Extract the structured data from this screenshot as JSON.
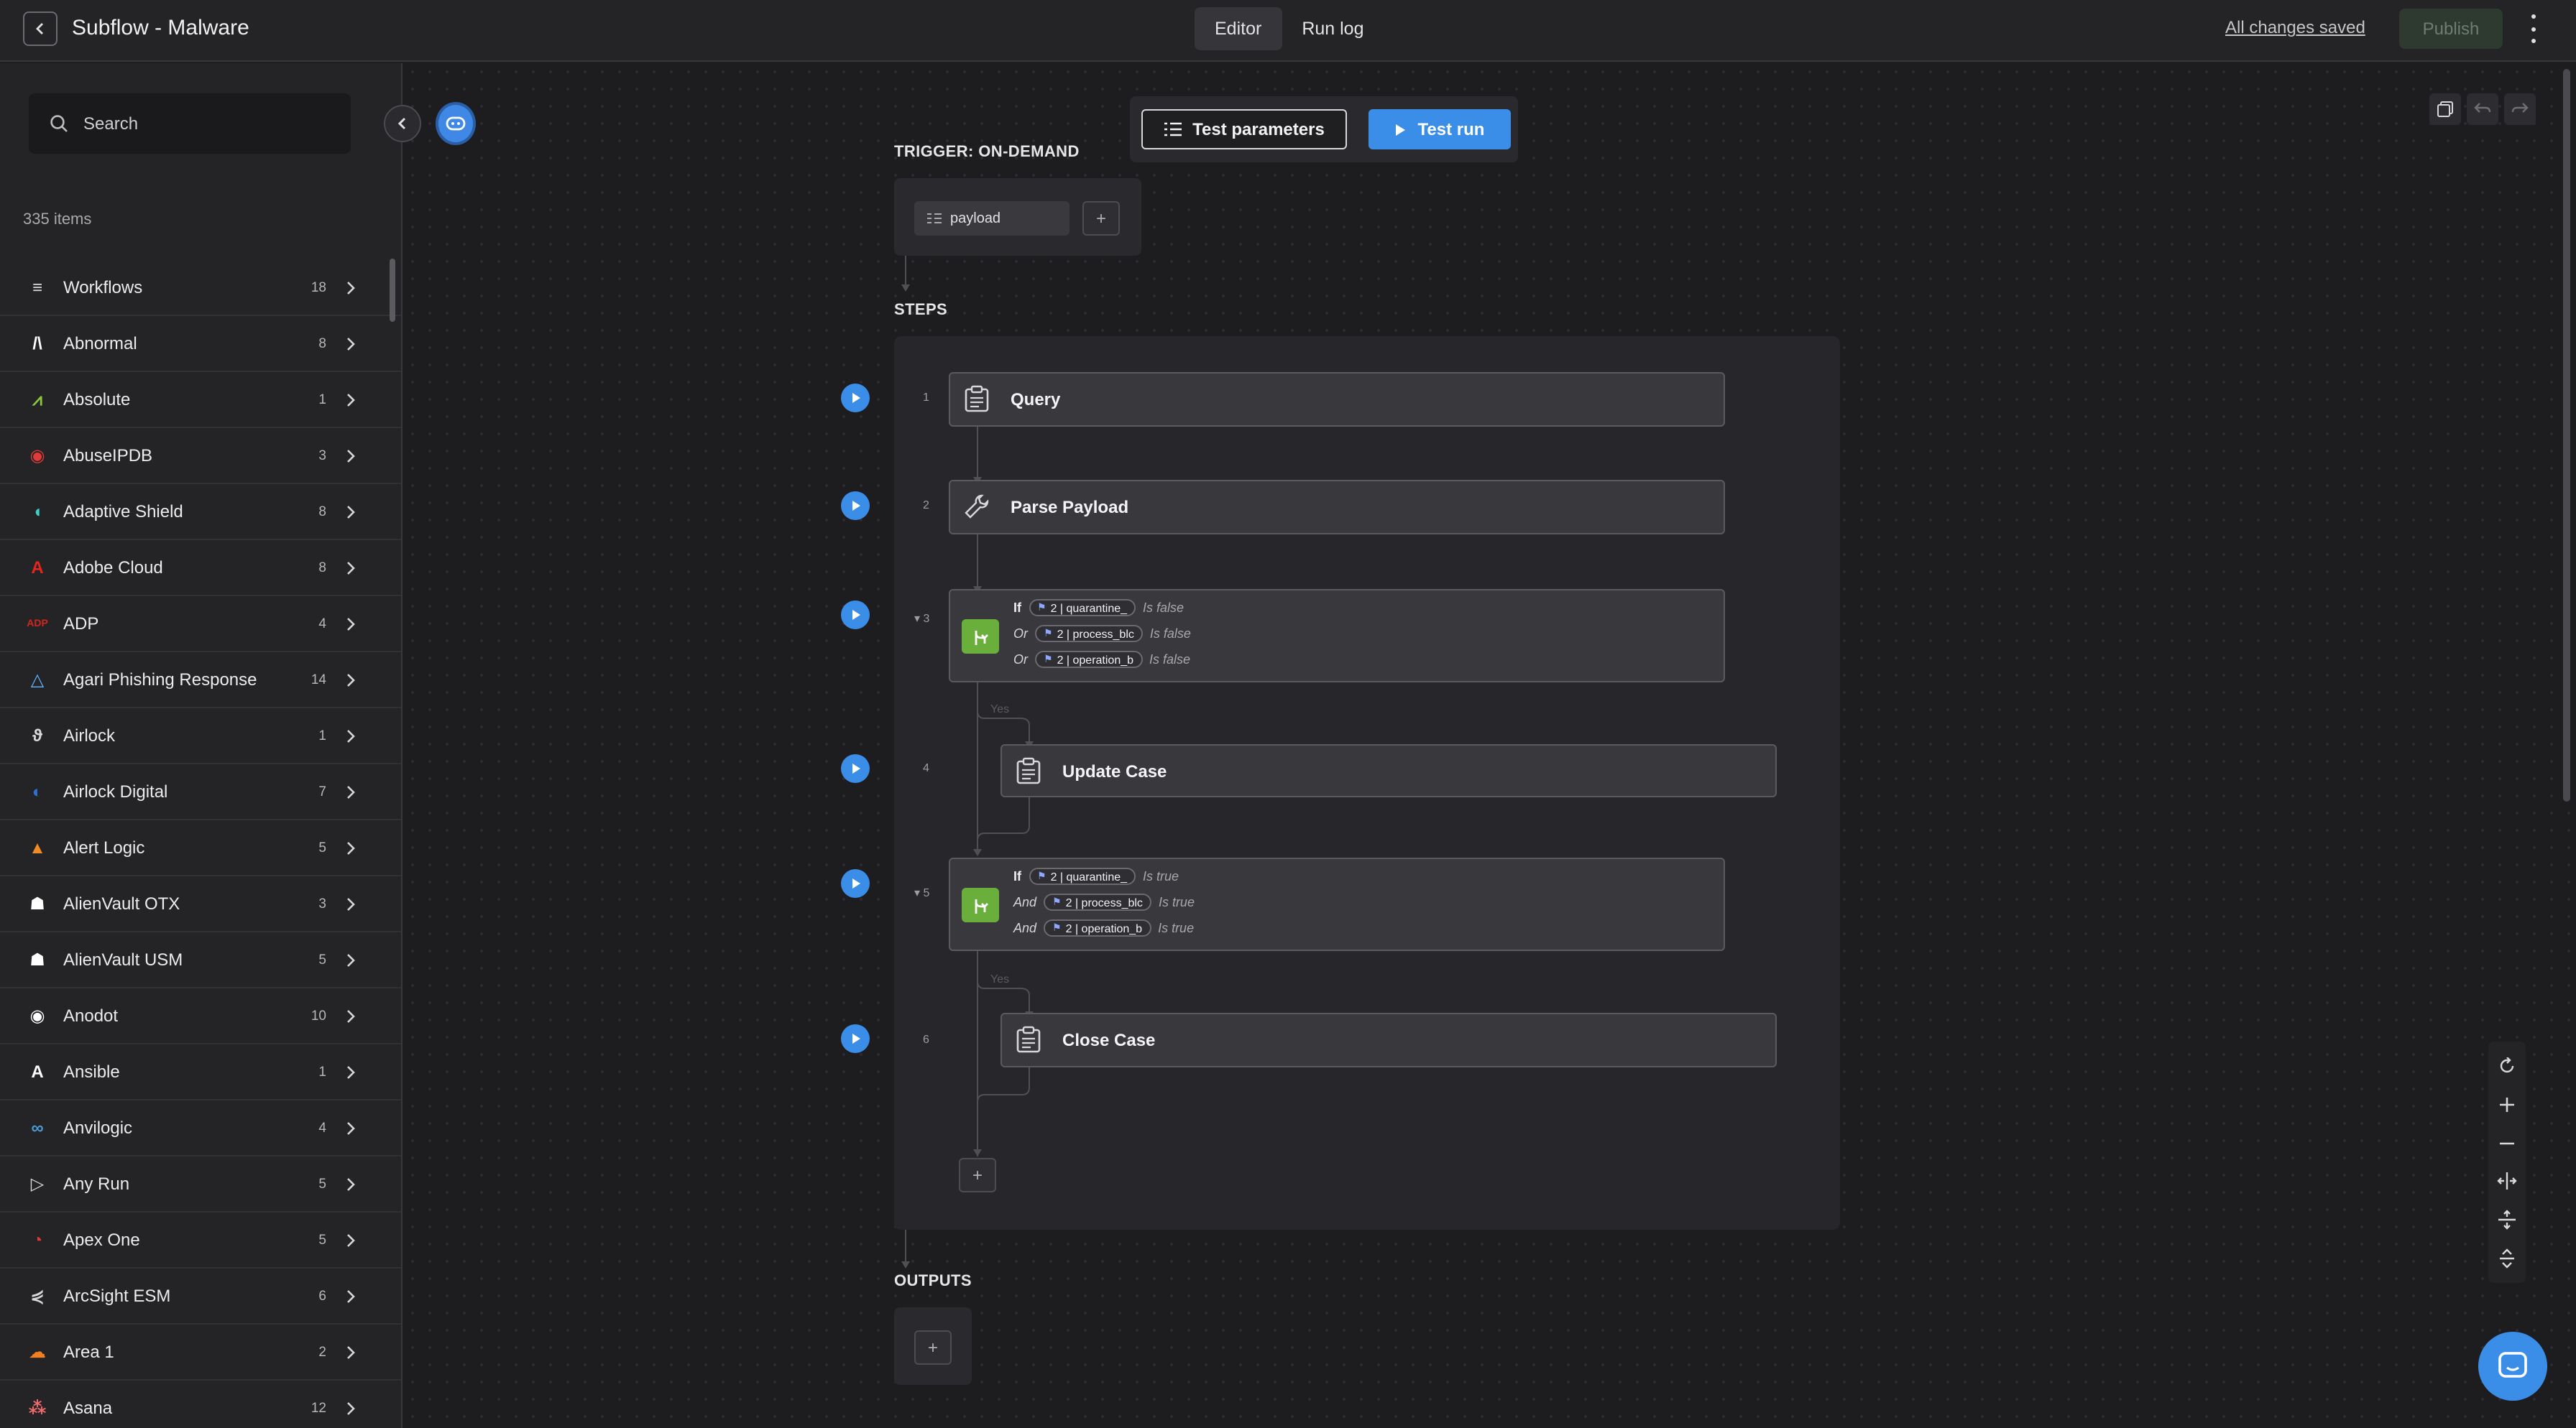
{
  "header": {
    "title": "Subflow - Malware",
    "tabs": [
      {
        "label": "Editor",
        "active": true
      },
      {
        "label": "Run log",
        "active": false
      }
    ],
    "saved_status": "All changes saved",
    "publish_label": "Publish"
  },
  "sidebar": {
    "search_placeholder": "Search",
    "items_count": "335 items",
    "items": [
      {
        "name": "Workflows",
        "count": "18",
        "icon": "workflows-icon",
        "color": "#d8d8db"
      },
      {
        "name": "Abnormal",
        "count": "8",
        "icon": "abnormal-logo",
        "color": "#ffffff"
      },
      {
        "name": "Absolute",
        "count": "1",
        "icon": "absolute-logo",
        "color": "#8cc63f"
      },
      {
        "name": "AbuseIPDB",
        "count": "3",
        "icon": "abuseipdb-logo",
        "color": "#e03a3a"
      },
      {
        "name": "Adaptive Shield",
        "count": "8",
        "icon": "adaptive-shield-logo",
        "color": "#3fd0c9"
      },
      {
        "name": "Adobe Cloud",
        "count": "8",
        "icon": "adobe-logo",
        "color": "#e5261f"
      },
      {
        "name": "ADP",
        "count": "4",
        "icon": "adp-logo",
        "color": "#d0271d"
      },
      {
        "name": "Agari Phishing Response",
        "count": "14",
        "icon": "agari-logo",
        "color": "#5fb8ff"
      },
      {
        "name": "Airlock",
        "count": "1",
        "icon": "airlock-logo",
        "color": "#d8d8db"
      },
      {
        "name": "Airlock Digital",
        "count": "7",
        "icon": "airlock-digital-logo",
        "color": "#2f6fd6"
      },
      {
        "name": "Alert Logic",
        "count": "5",
        "icon": "alert-logic-logo",
        "color": "#f08a24"
      },
      {
        "name": "AlienVault OTX",
        "count": "3",
        "icon": "alien-icon",
        "color": "#ffffff"
      },
      {
        "name": "AlienVault USM",
        "count": "5",
        "icon": "alien-icon",
        "color": "#ffffff"
      },
      {
        "name": "Anodot",
        "count": "10",
        "icon": "anodot-logo",
        "color": "#ffffff"
      },
      {
        "name": "Ansible",
        "count": "1",
        "icon": "ansible-logo",
        "color": "#ffffff"
      },
      {
        "name": "Anvilogic",
        "count": "4",
        "icon": "anvilogic-logo",
        "color": "#4a9bd6"
      },
      {
        "name": "Any Run",
        "count": "5",
        "icon": "any-run-logo",
        "color": "#d8d8db"
      },
      {
        "name": "Apex One",
        "count": "5",
        "icon": "apex-one-logo",
        "color": "#e03a3a"
      },
      {
        "name": "ArcSight ESM",
        "count": "6",
        "icon": "arcsight-logo",
        "color": "#d8d8db"
      },
      {
        "name": "Area 1",
        "count": "2",
        "icon": "area1-logo",
        "color": "#f38020"
      },
      {
        "name": "Asana",
        "count": "12",
        "icon": "asana-logo",
        "color": "#f06a6a"
      }
    ]
  },
  "editor": {
    "test_parameters_label": "Test parameters",
    "test_run_label": "Test run",
    "trigger_label": "TRIGGER: ON-DEMAND",
    "payload_label": "payload",
    "steps_label": "STEPS",
    "outputs_label": "OUTPUTS",
    "add_label": "+",
    "yes_label": "Yes",
    "steps": [
      {
        "num": "1",
        "title": "Query",
        "type": "action"
      },
      {
        "num": "2",
        "title": "Parse Payload",
        "type": "tool"
      },
      {
        "num": "3",
        "type": "condition",
        "lines": [
          {
            "kw": "If",
            "ref": "2 | quarantine_",
            "state": "Is false"
          },
          {
            "kw": "Or",
            "ref": "2 | process_blc",
            "state": "Is false"
          },
          {
            "kw": "Or",
            "ref": "2 | operation_b",
            "state": "Is false"
          }
        ]
      },
      {
        "num": "4",
        "title": "Update Case",
        "type": "action"
      },
      {
        "num": "5",
        "type": "condition",
        "lines": [
          {
            "kw": "If",
            "ref": "2 | quarantine_",
            "state": "Is true"
          },
          {
            "kw": "And",
            "ref": "2 | process_blc",
            "state": "Is true"
          },
          {
            "kw": "And",
            "ref": "2 | operation_b",
            "state": "Is true"
          }
        ]
      },
      {
        "num": "6",
        "title": "Close Case",
        "type": "action"
      }
    ]
  },
  "colors": {
    "accent": "#3b8ee8",
    "condition_green": "#6aaf3c",
    "background": "#1d1d20"
  }
}
